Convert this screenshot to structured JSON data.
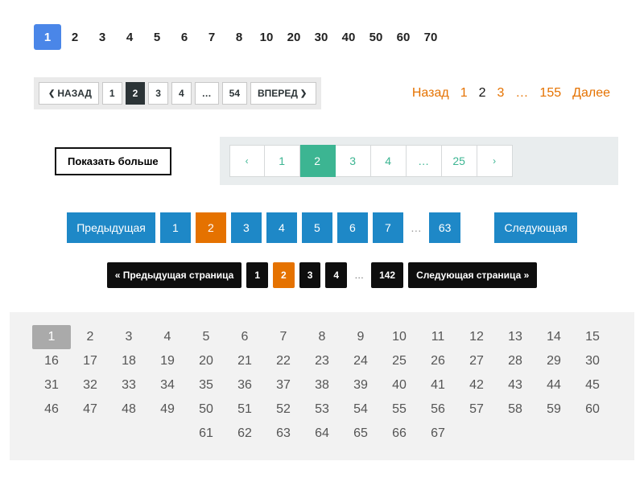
{
  "pager1": {
    "items": [
      "1",
      "2",
      "3",
      "4",
      "5",
      "6",
      "7",
      "8",
      "10",
      "20",
      "30",
      "40",
      "50",
      "60",
      "70"
    ],
    "active_index": 0
  },
  "pager2": {
    "prev": "НАЗАД",
    "next": "ВПЕРЕД",
    "items": [
      "1",
      "2",
      "3",
      "4",
      "…",
      "54"
    ],
    "active_index": 1
  },
  "pager3": {
    "prev": "Назад",
    "next": "Далее",
    "items": [
      "1",
      "2",
      "3",
      "…",
      "155"
    ],
    "dark_index": 1
  },
  "show_more": "Показать больше",
  "pager4": {
    "items": [
      "1",
      "2",
      "3",
      "4",
      "…",
      "25"
    ],
    "active_index": 1
  },
  "pager5": {
    "prev": "Предыдущая",
    "next": "Следующая",
    "items": [
      "1",
      "2",
      "3",
      "4",
      "5",
      "6",
      "7"
    ],
    "ellipsis": "…",
    "last": "63",
    "active_index": 1
  },
  "pager6": {
    "prev": "« Предыдущая страница",
    "next": "Следующая страница »",
    "items": [
      "1",
      "2",
      "3",
      "4"
    ],
    "ellipsis": "…",
    "last": "142",
    "active_index": 1
  },
  "grid": {
    "count": 67,
    "active": 1
  }
}
